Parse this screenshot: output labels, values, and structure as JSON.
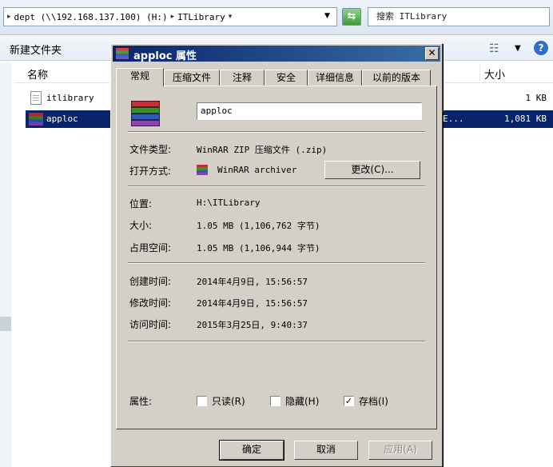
{
  "explorer": {
    "address": {
      "segment_1": "dept (\\\\192.168.137.100) (H:)",
      "segment_2": "ITLibrary"
    },
    "search_placeholder": "搜索 ITLibrary",
    "toolbar": {
      "new_folder_label": "新建文件夹"
    },
    "columns": {
      "name": "名称",
      "size": "大小"
    },
    "files": [
      {
        "name": "itlibrary",
        "type": "",
        "size": "1 KB",
        "selected": false
      },
      {
        "name": "apploc",
        "type": "E...",
        "size": "1,081 KB",
        "selected": true
      }
    ]
  },
  "dialog": {
    "title": "apploc 属性",
    "tabs": [
      "常规",
      "压缩文件",
      "注释",
      "安全",
      "详细信息",
      "以前的版本"
    ],
    "active_tab": 0,
    "file_name": "apploc",
    "file_type": {
      "label": "文件类型:",
      "value": "WinRAR ZIP 压缩文件 (.zip)"
    },
    "open_with": {
      "label": "打开方式:",
      "value": "WinRAR archiver",
      "change_button": "更改(C)..."
    },
    "location": {
      "label": "位置:",
      "value": "H:\\ITLibrary"
    },
    "size": {
      "label": "大小:",
      "value": "1.05 MB (1,106,762 字节)"
    },
    "size_on_disk": {
      "label": "占用空间:",
      "value": "1.05 MB (1,106,944 字节)"
    },
    "created": {
      "label": "创建时间:",
      "value": "2014年4月9日, 15:56:57"
    },
    "modified": {
      "label": "修改时间:",
      "value": "2014年4月9日, 15:56:57"
    },
    "accessed": {
      "label": "访问时间:",
      "value": "2015年3月25日, 9:40:37"
    },
    "attributes": {
      "label": "属性:",
      "readonly": {
        "label": "只读(R)",
        "checked": false
      },
      "hidden": {
        "label": "隐藏(H)",
        "checked": false
      },
      "archive": {
        "label": "存档(I)",
        "checked": true
      }
    },
    "buttons": {
      "ok": "确定",
      "cancel": "取消",
      "apply": "应用(A)"
    },
    "colors": {
      "titlebar": "#0a246a",
      "face": "#d4d0c8",
      "selection": "#0a246a"
    }
  }
}
